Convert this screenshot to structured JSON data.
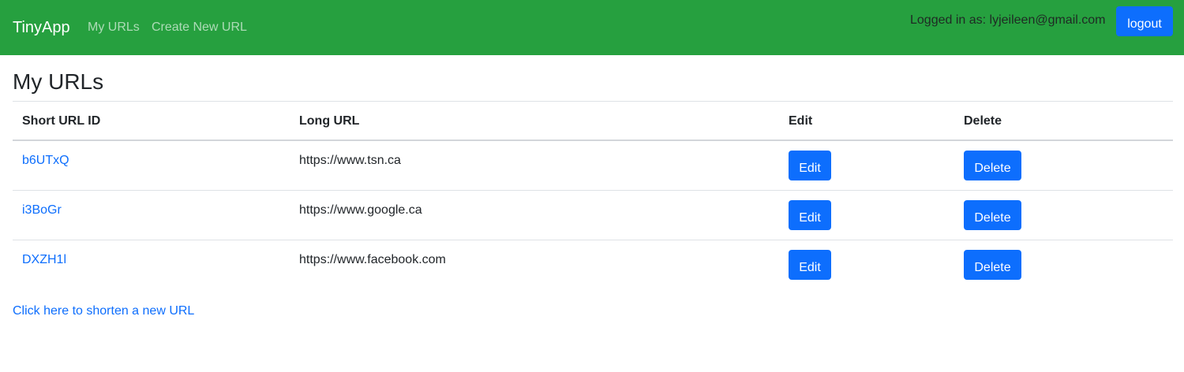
{
  "navbar": {
    "brand": "TinyApp",
    "links": [
      "My URLs",
      "Create New URL"
    ],
    "logged_in_text": "Logged in as: lyjeileen@gmail.com",
    "logout_label": "logout",
    "bg_color": "#26a03f"
  },
  "page_title": "My URLs",
  "table": {
    "headers": [
      "Short URL ID",
      "Long URL",
      "Edit",
      "Delete"
    ],
    "rows": [
      {
        "short_id": "b6UTxQ",
        "long_url": "https://www.tsn.ca",
        "edit_label": "Edit",
        "delete_label": "Delete"
      },
      {
        "short_id": "i3BoGr",
        "long_url": "https://www.google.ca",
        "edit_label": "Edit",
        "delete_label": "Delete"
      },
      {
        "short_id": "DXZH1l",
        "long_url": "https://www.facebook.com",
        "edit_label": "Edit",
        "delete_label": "Delete"
      }
    ]
  },
  "shorten_link": "Click here to shorten a new URL",
  "colors": {
    "primary": "#0d6efd",
    "link": "#0d6efd"
  }
}
